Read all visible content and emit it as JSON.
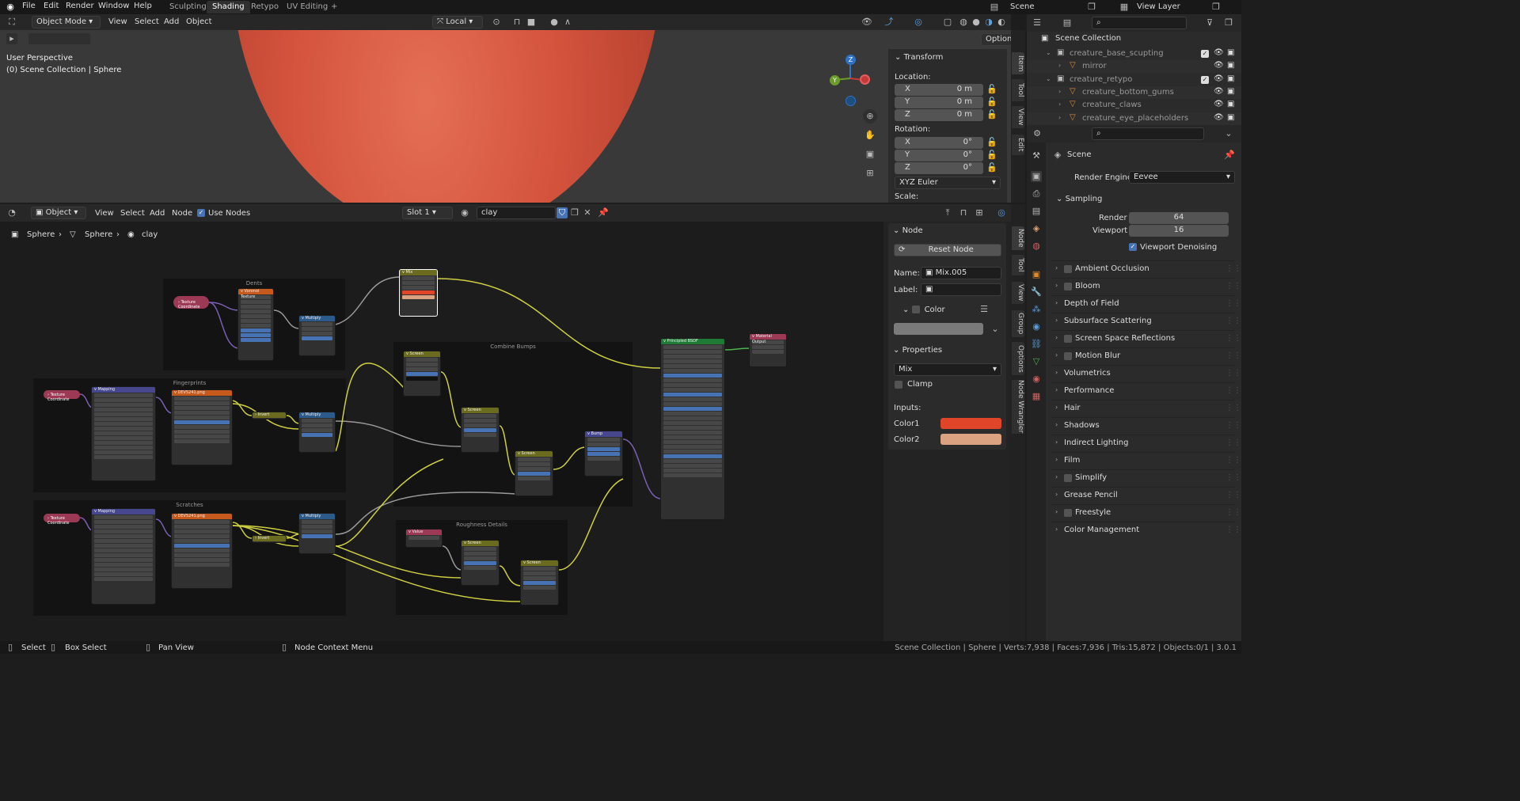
{
  "menubar": {
    "items": [
      "File",
      "Edit",
      "Render",
      "Window",
      "Help"
    ],
    "workspaces": [
      "Sculpting",
      "Shading",
      "Retypo",
      "UV Editing"
    ],
    "active_workspace": "Shading",
    "add": "+",
    "scene": "Scene",
    "view_layer": "View Layer"
  },
  "viewport_header": {
    "mode": "Object Mode",
    "menus": [
      "View",
      "Select",
      "Add",
      "Object"
    ],
    "transform_orient": "Local",
    "options": "Options"
  },
  "viewport": {
    "perspective": "User Perspective",
    "collection_info": "(0) Scene Collection | Sphere",
    "gizmo": {
      "x": "X",
      "y": "Y",
      "z": "Z"
    }
  },
  "transform_panel": {
    "title": "Transform",
    "location_label": "Location:",
    "location": [
      {
        "axis": "X",
        "value": "0 m"
      },
      {
        "axis": "Y",
        "value": "0 m"
      },
      {
        "axis": "Z",
        "value": "0 m"
      }
    ],
    "rotation_label": "Rotation:",
    "rotation": [
      {
        "axis": "X",
        "value": "0°"
      },
      {
        "axis": "Y",
        "value": "0°"
      },
      {
        "axis": "Z",
        "value": "0°"
      }
    ],
    "rotation_mode": "XYZ Euler",
    "scale_label": "Scale:"
  },
  "viewport_tabs": [
    "Item",
    "Tool",
    "View",
    "Edit"
  ],
  "node_header": {
    "object": "Object",
    "menus": [
      "View",
      "Select",
      "Add",
      "Node"
    ],
    "use_nodes": "Use Nodes",
    "slot": "Slot 1",
    "material": "clay"
  },
  "breadcrumb": [
    "Sphere",
    "Sphere",
    "clay"
  ],
  "node_panel": {
    "title": "Node",
    "reset": "Reset Node",
    "name_label": "Name:",
    "name_value": "Mix.005",
    "label_label": "Label:",
    "color_label": "Color",
    "properties_title": "Properties",
    "blend_mode": "Mix",
    "clamp": "Clamp",
    "inputs_label": "Inputs:",
    "color1": "Color1",
    "color2": "Color2",
    "color1_swatch": "#e0452a",
    "color2_swatch": "#dba282"
  },
  "node_tabs": [
    "Node",
    "Tool",
    "View",
    "Group",
    "Options",
    "Node Wrangler"
  ],
  "frames": {
    "dents": "Dents",
    "fingerprints": "Fingerprints",
    "scratches": "Scratches",
    "combine": "Combine Bumps",
    "roughness": "Roughness Details"
  },
  "outliner": {
    "root": "Scene Collection",
    "items": [
      {
        "name": "creature_base_scupting",
        "indent": 0
      },
      {
        "name": "mirror",
        "indent": 1
      },
      {
        "name": "creature_retypo",
        "indent": 0
      },
      {
        "name": "creature_bottom_gums",
        "indent": 1
      },
      {
        "name": "creature_claws",
        "indent": 1
      },
      {
        "name": "creature_eye_placeholders",
        "indent": 1
      }
    ]
  },
  "properties": {
    "scene": "Scene",
    "render_engine_label": "Render Engine",
    "render_engine": "Eevee",
    "sampling": "Sampling",
    "render_label": "Render",
    "render_value": "64",
    "viewport_label": "Viewport",
    "viewport_value": "16",
    "denoise": "Viewport Denoising",
    "sections": [
      {
        "label": "Ambient Occlusion",
        "cb": true
      },
      {
        "label": "Bloom",
        "cb": true
      },
      {
        "label": "Depth of Field",
        "cb": false
      },
      {
        "label": "Subsurface Scattering",
        "cb": false
      },
      {
        "label": "Screen Space Reflections",
        "cb": true
      },
      {
        "label": "Motion Blur",
        "cb": true
      },
      {
        "label": "Volumetrics",
        "cb": false
      },
      {
        "label": "Performance",
        "cb": false
      },
      {
        "label": "Hair",
        "cb": false
      },
      {
        "label": "Shadows",
        "cb": false
      },
      {
        "label": "Indirect Lighting",
        "cb": false
      },
      {
        "label": "Film",
        "cb": false
      },
      {
        "label": "Simplify",
        "cb": true
      },
      {
        "label": "Grease Pencil",
        "cb": false
      },
      {
        "label": "Freestyle",
        "cb": true
      },
      {
        "label": "Color Management",
        "cb": false
      }
    ]
  },
  "statusbar": {
    "select": "Select",
    "box_select": "Box Select",
    "pan": "Pan View",
    "context": "Node Context Menu",
    "stats": "Scene Collection | Sphere | Verts:7,938 | Faces:7,936 | Tris:15,872 | Objects:0/1 | 3.0.1"
  }
}
